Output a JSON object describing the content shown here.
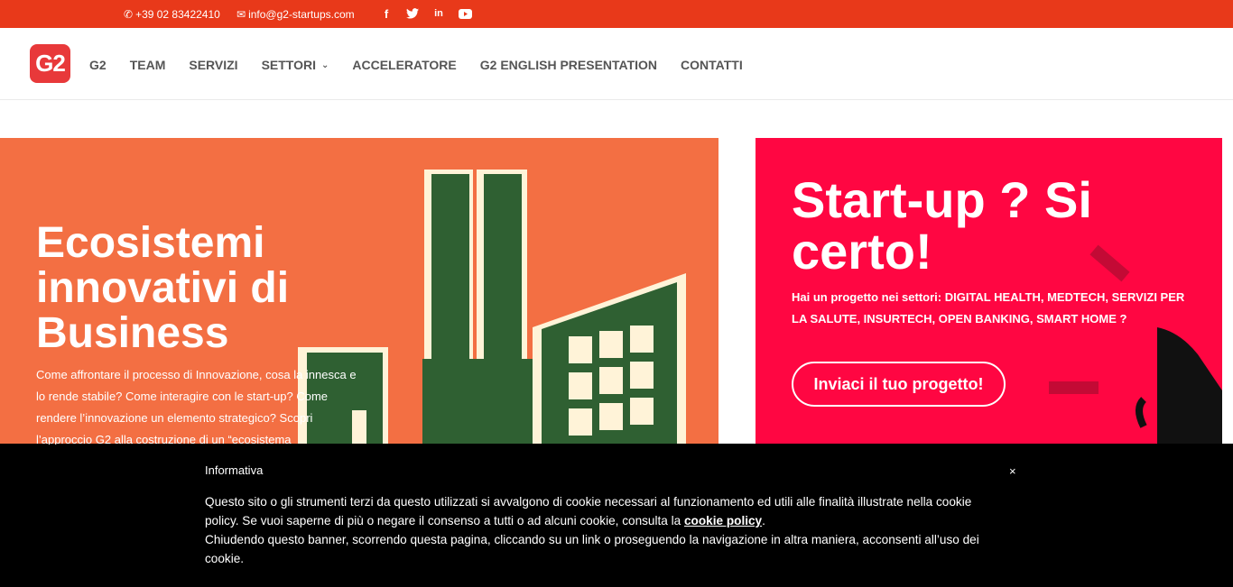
{
  "topbar": {
    "phone": "+39 02 83422410",
    "email": "info@g2-startups.com",
    "social": [
      "f",
      "🐦",
      "in",
      "▶"
    ]
  },
  "logo": {
    "text": "G2"
  },
  "nav": [
    {
      "label": "G2"
    },
    {
      "label": "TEAM"
    },
    {
      "label": "SERVIZI"
    },
    {
      "label": "SETTORI",
      "dropdown": true
    },
    {
      "label": "ACCELERATORE"
    },
    {
      "label": "G2 ENGLISH PRESENTATION"
    },
    {
      "label": "CONTATTI"
    }
  ],
  "hero_left": {
    "title": "Ecosistemi innovativi di Business",
    "text": "Come affrontare il processo di Innovazione, cosa la innesca e lo rende stabile? Come interagire con le start-up? Come rendere l’innovazione un elemento strategico? Scopri l’approccio G2 alla costruzione di un “ecosistema"
  },
  "hero_right": {
    "title": "Start-up ? Si certo!",
    "text": "Hai un progetto nei settori: DIGITAL HEALTH, MEDTECH, SERVIZI PER LA SALUTE, INSURTECH, OPEN BANKING, SMART HOME ?",
    "button": "Inviaci il tuo progetto!"
  },
  "cookie": {
    "title": "Informativa",
    "close": "×",
    "text1": "Questo sito o gli strumenti terzi da questo utilizzati si avvalgono di cookie necessari al funzionamento ed utili alle finalità illustrate nella cookie policy. Se vuoi saperne di più o negare il consenso a tutti o ad alcuni cookie, consulta la ",
    "link": "cookie policy",
    "text2": ".",
    "text3": "Chiudendo questo banner, scorrendo questa pagina, cliccando su un link o proseguendo la navigazione in altra maniera, acconsenti all’uso dei cookie."
  },
  "colors": {
    "topbar": "#e8391a",
    "hero_left": "#f36f43",
    "hero_right": "#ff0642",
    "factory_green": "#2f6032"
  }
}
